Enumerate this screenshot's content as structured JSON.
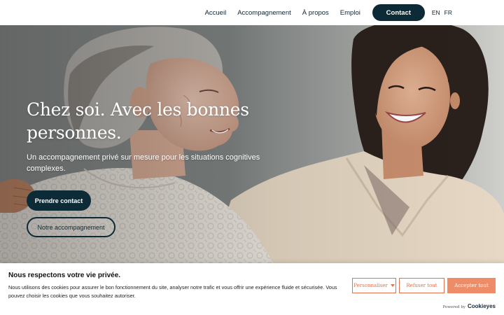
{
  "header": {
    "nav": [
      "Accueil",
      "Accompagnement",
      "À propos",
      "Emploi"
    ],
    "contact_label": "Contact",
    "languages": [
      "EN",
      "FR"
    ]
  },
  "hero": {
    "title_line1": "Chez soi. Avec les bonnes",
    "title_line2": "personnes.",
    "subtitle": "Un accompagnement privé sur mesure pour les situations cognitives complexes.",
    "primary_button": "Prendre contact",
    "secondary_button": "Notre accompagnement"
  },
  "cookie": {
    "title": "Nous respectons votre vie privée.",
    "text": "Nous utilisons des cookies pour assurer le bon fonctionnement du site, analyser notre trafic et vous offrir une expérience fluide et sécurisée. Vous pouvez choisir les cookies que vous souhaitez autoriser.",
    "customize_label": "Personnaliser",
    "reject_label": "Refuser tout",
    "accept_label": "Accepter tout",
    "powered_by": "Powered by",
    "brand": "Cookieyes"
  },
  "colors": {
    "brand_dark": "#0d2b36",
    "accent": "#e0734d",
    "accept_bg": "#ee8c67"
  }
}
